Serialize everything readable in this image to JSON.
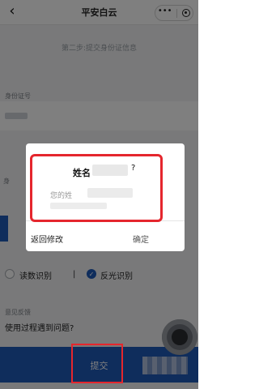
{
  "navbar": {
    "title": "平安白云",
    "back_icon": "chevron-left-icon",
    "more_icon": "more-dots-icon",
    "close_icon": "target-icon"
  },
  "form": {
    "step_text": "第二步:提交身份证信息",
    "id_label": "身份证号",
    "id_value_masked": "",
    "side_label": "身",
    "recognition": {
      "option1": "读数识别",
      "divider": "|",
      "option2": "反光识别",
      "selected": "反光识别"
    },
    "feedback_label": "意见反馈",
    "feedback_text": "使用过程遇到问题?",
    "submit_label": "提交"
  },
  "dialog": {
    "title_prefix": "姓名",
    "title_suffix": "?",
    "body_prefix": "您的姓",
    "cancel_label": "返回修改",
    "confirm_label": "确定"
  },
  "colors": {
    "primary_blue": "#1f5ab8",
    "highlight_red": "#e5262d",
    "overlay": "rgba(0,0,0,0.5)"
  }
}
